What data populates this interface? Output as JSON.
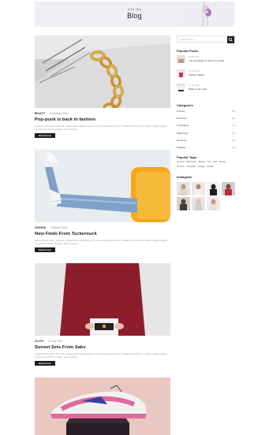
{
  "header": {
    "breadcrumb": "Home / Blog",
    "title": "Blog"
  },
  "posts": [
    {
      "category": "BEAUTY",
      "date": "03 January 2021",
      "title": "Pop-punk is back in fashion",
      "excerpt": "Lorem ipsum dolor sit amet, consectetur adipiscing elit, sed do eiusmod tempor incididunt ut labore et dolore magna aliqua. Ut enim ad minim veniam, quis nostrud",
      "button": "Read more",
      "image": "gold-chain-necklace-on-magazine"
    },
    {
      "category": "FASHION",
      "date": "19 March 2021",
      "title": "New Finds From Tuckernuck",
      "excerpt": "Lorem ipsum dolor sit amet, consectetur adipiscing elit, sed do eiusmod tempor incididunt ut labore et dolore magna aliqua. Ut enim ad minim veniam, quis nostrud",
      "button": "Read more",
      "image": "legs-in-jeans-and-sneakers-on-yellow-chair"
    },
    {
      "category": "CLOTH",
      "date": "14 July 2021",
      "title": "Sunset Sets From Saks",
      "excerpt": "Lorem ipsum dolor sit amet, consectetur adipiscing elit, sed do eiusmod tempor incididunt ut labore et dolore magna aliqua. Ut enim ad minim veniam, quis nostrud",
      "button": "Read more",
      "image": "woman-in-red-sweater-holding-clutch"
    }
  ],
  "post_preview_image": "pink-sneaker-on-shoebox",
  "sidebar": {
    "search_placeholder": "Search Here...",
    "popular_posts_title": "Popular Posts",
    "popular_posts": [
      {
        "date": "14 Mar 2021",
        "title": "The best deals to shop from Chair"
      },
      {
        "date": "08 Feb 2021",
        "title": "Fashion Tastes"
      },
      {
        "date": "12 Jan 2021",
        "title": "Sharp in pin solid"
      }
    ],
    "categories_title": "Categories",
    "categories": [
      {
        "name": "Articles",
        "count": "(9)"
      },
      {
        "name": "Business",
        "count": "(5)"
      },
      {
        "name": "Consulting",
        "count": "(1)"
      },
      {
        "name": "Marketing",
        "count": "(3)"
      },
      {
        "name": "Personal",
        "count": "(4)"
      },
      {
        "name": "Strategy",
        "count": "(1)"
      }
    ],
    "tags_title": "Popular Tags",
    "tags": [
      "Amazon",
      "Bluechator",
      "Beauty",
      "Cart",
      "Test",
      "Clients",
      "Summer",
      "Complete",
      "Vintage",
      "Guides"
    ],
    "instagram_title": "Instagram"
  },
  "colors": {
    "hero_bg": "#f1eff3",
    "button_bg": "#1e1e1e",
    "accent_yellow": "#f4a81d",
    "accent_red": "#8d1d2b",
    "accent_pink": "#e06a9a"
  }
}
